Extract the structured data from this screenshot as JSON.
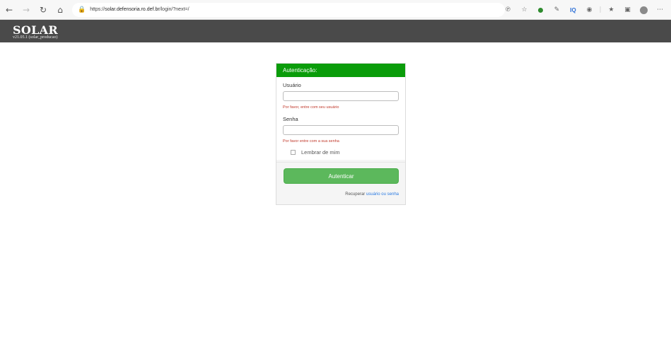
{
  "browser": {
    "url_prefix": "https://",
    "url_host": "solar.defensoria.ro.def.br",
    "url_path": "/login/?next=/",
    "icons": [
      "back-icon",
      "forward-icon",
      "refresh-icon",
      "home-icon",
      "lock-icon",
      "read-aloud-icon",
      "favorite-add-icon",
      "extension-icon",
      "edit-icon",
      "iq-extension-icon",
      "extension-puzzle-icon",
      "favorites-icon",
      "collections-icon",
      "profile-avatar",
      "more-icon"
    ],
    "iq_label": "IQ"
  },
  "app": {
    "brand": "SOLAR",
    "version": "v21.05.1 (solar_producao)"
  },
  "login": {
    "title": "Autenticação:",
    "username_label": "Usuário",
    "username_value": "",
    "username_error": "Por favor, entre com seu usuário",
    "password_label": "Senha",
    "password_value": "",
    "password_error": "Por favor entre com a sua senha",
    "remember_label": "Lembrar de mim",
    "submit_label": "Autenticar",
    "recover_prefix": "Recuperar ",
    "recover_link": "usuário ou senha"
  },
  "colors": {
    "header_bg": "#4a4a4a",
    "panel_head": "#0a9c0a",
    "submit": "#5cb85c",
    "error": "#c0392b",
    "link": "#2a7ae2"
  }
}
